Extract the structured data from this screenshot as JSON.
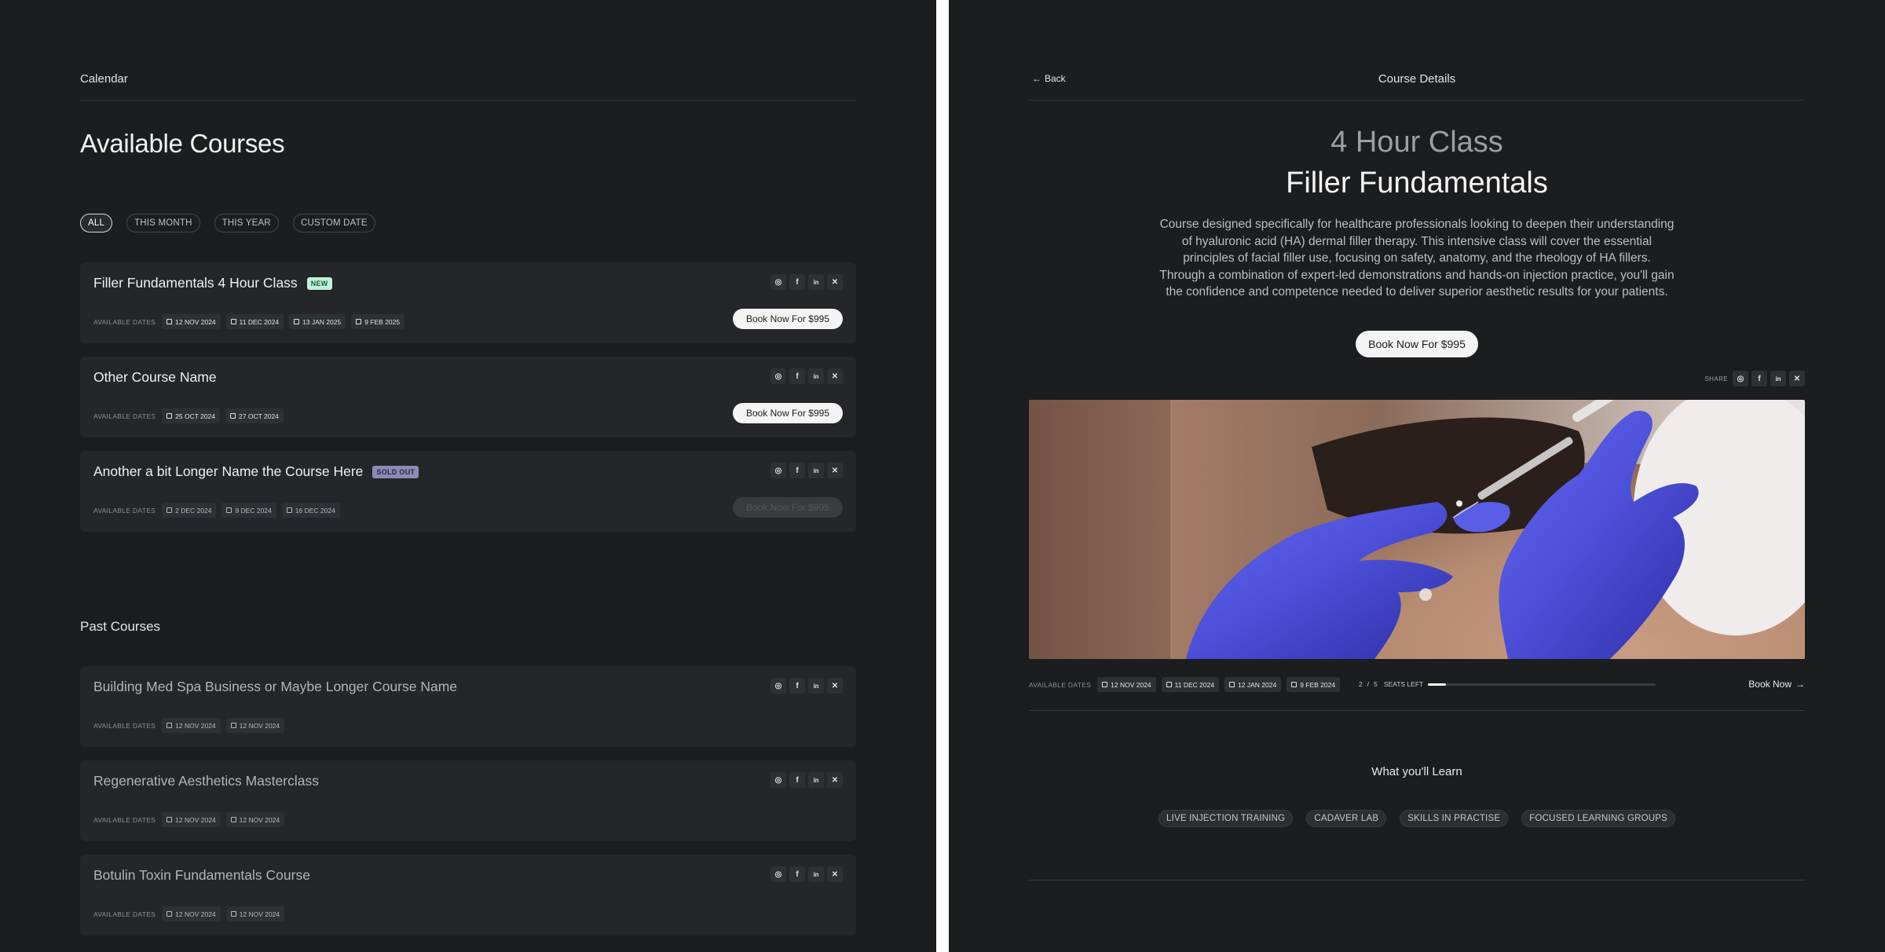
{
  "left": {
    "header_label": "Calendar",
    "title": "Available Courses",
    "filters": [
      "ALL",
      "THIS MONTH",
      "THIS YEAR",
      "CUSTOM DATE"
    ],
    "available_dates_label": "AVAILABLE DATES",
    "courses": [
      {
        "name": "Filler Fundamentals 4 Hour Class",
        "badge": "NEW",
        "dates": [
          "12 NOV 2024",
          "11 DEC 2024",
          "13 JAN 2025",
          "9 FEB 2025"
        ],
        "cta": "Book Now For $995"
      },
      {
        "name": "Other Course Name",
        "badge": "",
        "dates": [
          "25 OCT 2024",
          "27 OCT 2024"
        ],
        "cta": "Book Now For $995"
      },
      {
        "name": "Another a bit Longer Name the Course Here",
        "badge": "SOLD OUT",
        "dates": [
          "2 DEC 2024",
          "9 DEC 2024",
          "16 DEC 2024"
        ],
        "cta": "Book Now For $995"
      }
    ],
    "past_title": "Past Courses",
    "past_courses": [
      {
        "name": "Building Med Spa Business or Maybe Longer Course Name",
        "dates": [
          "12 NOV 2024",
          "12 NOV 2024"
        ]
      },
      {
        "name": "Regenerative Aesthetics Masterclass",
        "dates": [
          "12 NOV 2024",
          "12 NOV 2024"
        ]
      },
      {
        "name": "Botulin Toxin Fundamentals Course",
        "dates": [
          "12 NOV 2024",
          "12 NOV 2024"
        ]
      }
    ]
  },
  "right": {
    "back_label": "Back",
    "header_label": "Course Details",
    "subtitle": "4 Hour Class",
    "title": "Filler Fundamentals",
    "description": "Course designed specifically for healthcare professionals looking to deepen their understanding of hyaluronic acid (HA) dermal filler therapy. This intensive class will cover the essential principles of facial filler use, focusing on safety, anatomy, and the rheology of HA fillers. Through a combination of expert-led demonstrations and hands-on injection practice, you'll gain the confidence and competence needed to deliver superior aesthetic results for your patients.",
    "cta": "Book Now For $995",
    "share_label": "SHARE",
    "available_dates_label": "AVAILABLE DATES",
    "dates": [
      "12 NOV 2024",
      "11 DEC 2024",
      "12 JAN 2024",
      "9 FEB 2024"
    ],
    "seats": {
      "taken": "2",
      "separator": "/",
      "total": "5",
      "label": "SEATS LEFT",
      "fraction": 0.4
    },
    "book_now_link": "Book Now",
    "learn_title": "What you'll Learn",
    "tags": [
      "LIVE INJECTION TRAINING",
      "CADAVER LAB",
      "SKILLS IN PRACTISE",
      "FOCUSED LEARNING GROUPS"
    ]
  },
  "icons": {
    "social": [
      "instagram-icon",
      "facebook-icon",
      "linkedin-icon",
      "x-icon"
    ],
    "glyphs": {
      "instagram": "◎",
      "facebook": "f",
      "linkedin": "in",
      "x": "✕",
      "back_arrow": "←",
      "forward_arrow": "→"
    }
  },
  "colors": {
    "panel_bg": "#1c1d1f",
    "card_bg": "#252629",
    "new_badge": "#bff2d8",
    "sold_out_badge": "#8f89b5",
    "glove_blue": "#4b4ed6"
  }
}
